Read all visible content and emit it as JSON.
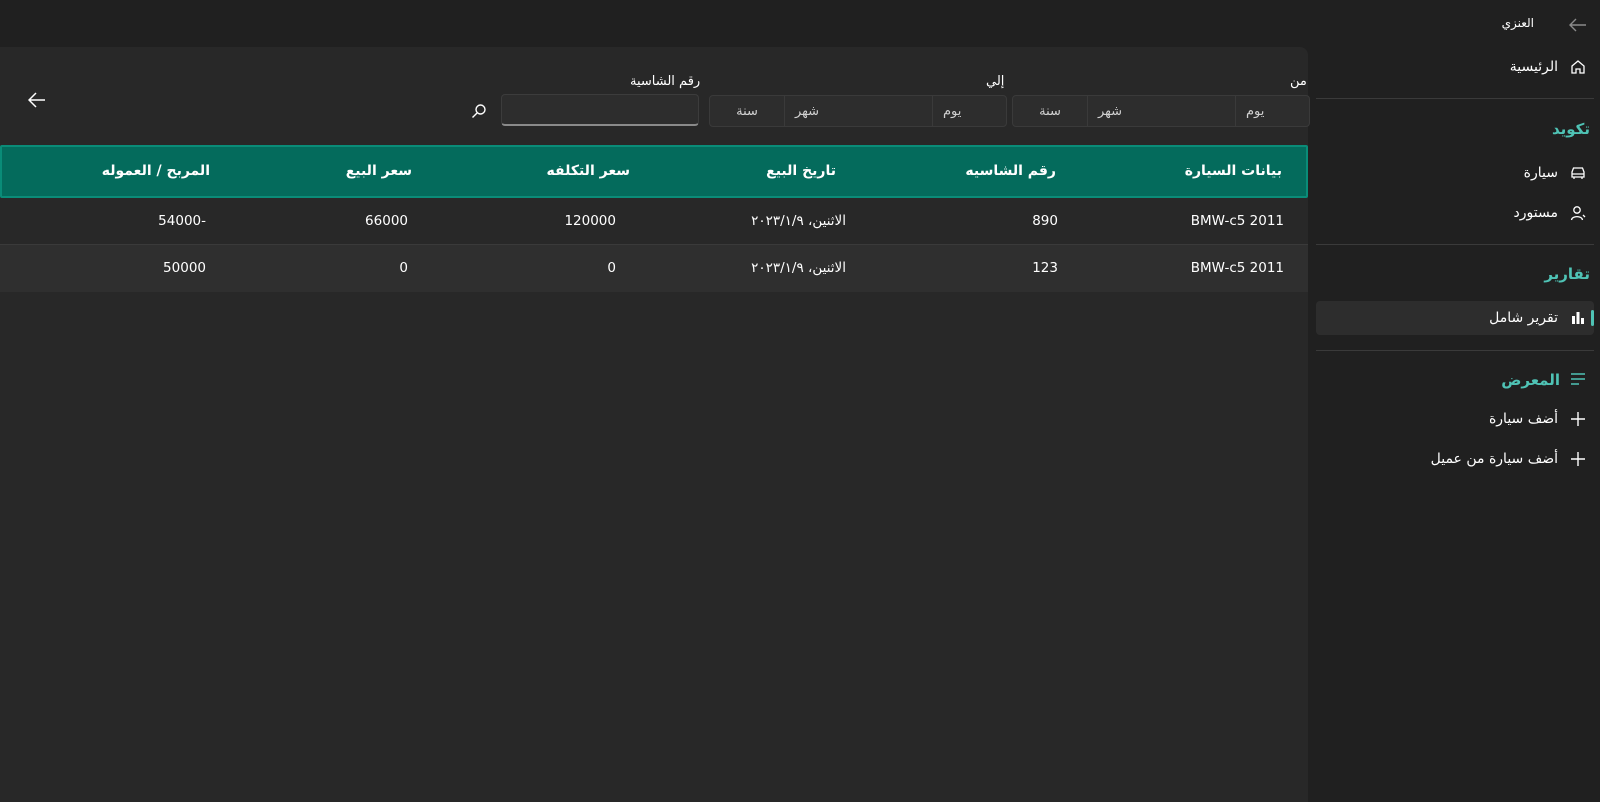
{
  "nav": {
    "title": "العنزي",
    "home": {
      "label": "الرئيسية",
      "icon": "home-icon"
    },
    "coding_header": "تكويد",
    "car": {
      "label": "سيارة",
      "icon": "car-icon"
    },
    "importer": {
      "label": "مستورد",
      "icon": "person-icon"
    },
    "reports_header": "تقارير",
    "full_report": {
      "label": "تقرير شامل",
      "icon": "chart-icon"
    },
    "showroom_header": {
      "label": "المعرض",
      "icon": "list-icon"
    },
    "add_car": {
      "label": "أضف سيارة",
      "icon": "plus-icon"
    },
    "add_car_client": {
      "label": "أضف سيارة من عميل",
      "icon": "plus-icon"
    }
  },
  "filters": {
    "from_label": "من",
    "to_label": "إلي",
    "chassis_label": "رقم الشاسية",
    "from": {
      "day": "يوم",
      "month": "شهر",
      "year": "سنة"
    },
    "to": {
      "day": "يوم",
      "month": "شهر",
      "year": "سنة"
    },
    "chassis_value": ""
  },
  "table": {
    "headers": [
      "بيانات السيارة",
      "رقم الشاسيه",
      "تاريخ البيع",
      "سعر التكلفه",
      "سعر البيع",
      "المربح / العموله"
    ],
    "rows": [
      [
        "BMW-c5 2011",
        "890",
        "الاثنين، ٢٠٢٣/١/٩",
        "120000",
        "66000",
        "54000-"
      ],
      [
        "BMW-c5 2011",
        "123",
        "الاثنين، ٢٠٢٣/١/٩",
        "0",
        "0",
        "50000"
      ]
    ]
  },
  "colors": {
    "accent": "#4fc3b5",
    "header_bg": "#046b5c",
    "background": "#202020",
    "content_bg": "#282828"
  }
}
